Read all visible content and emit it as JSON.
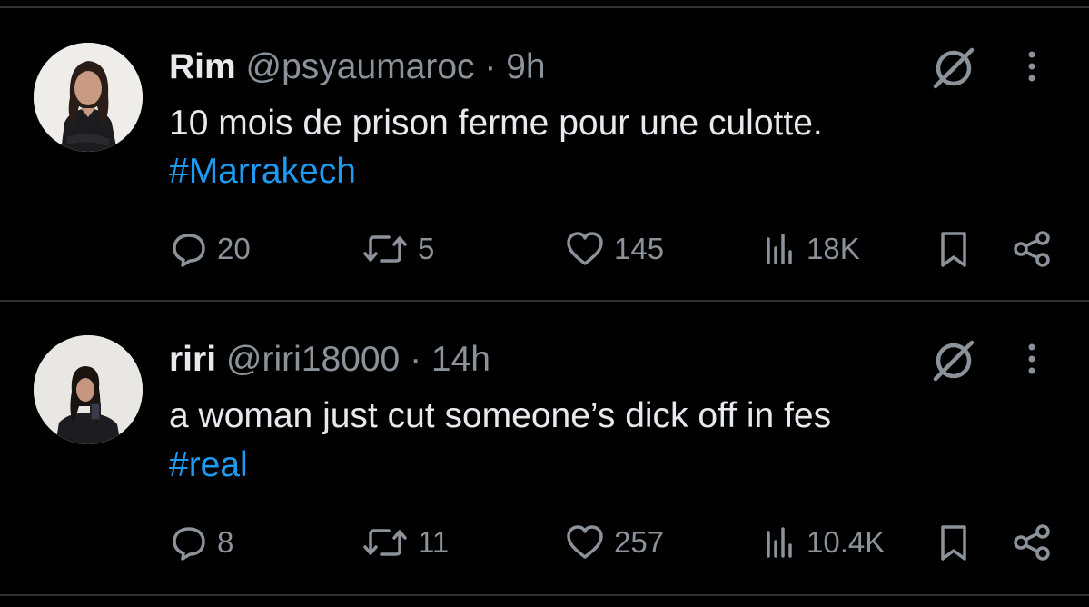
{
  "tweets": [
    {
      "display_name": "Rim",
      "handle": "@psyaumaroc",
      "separator": "·",
      "time": "9h",
      "text": "10 mois de prison ferme pour une culotte.",
      "hashtag": "#Marrakech",
      "replies": "20",
      "retweets": "5",
      "likes": "145",
      "views": "18K"
    },
    {
      "display_name": "riri",
      "handle": "@riri18000",
      "separator": "·",
      "time": "14h",
      "text": "a woman just cut someone’s dick off in fes",
      "hashtag": "#real",
      "replies": "8",
      "retweets": "11",
      "likes": "257",
      "views": "10.4K"
    }
  ],
  "icons": {
    "reply": "speech-bubble-icon",
    "retweet": "retweet-arrows-icon",
    "like": "heart-icon",
    "views": "bar-chart-icon",
    "bookmark": "bookmark-icon",
    "share": "share-nodes-icon",
    "grok": "grok-slash-circle-icon",
    "more": "vertical-ellipsis-icon"
  },
  "colors": {
    "background": "#000000",
    "text": "#e7e9ea",
    "muted": "#8b9299",
    "hashtag": "#1d9bf0",
    "divider": "#2f3336"
  }
}
